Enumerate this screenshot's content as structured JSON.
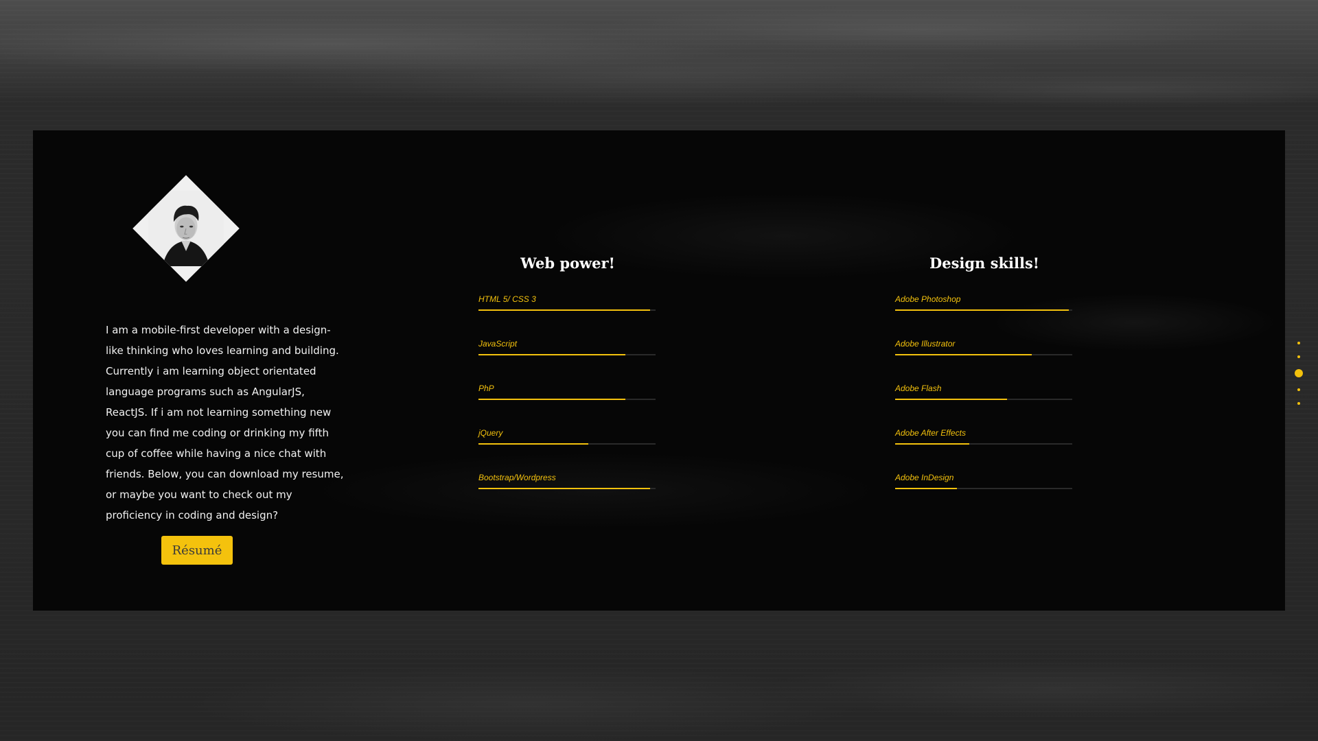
{
  "about": {
    "bio": "I am a mobile-first developer with a design-like thinking who loves learning and building. Currently i am learning object orientated language programs such as AngularJS, ReactJS. If i am not learning something new you can find me coding or drinking my fifth cup of coffee while having a nice chat with friends. Below, you can download my resume, or maybe you want to check out my proficiency in coding and design?",
    "resume_label": "Résumé"
  },
  "web": {
    "title": "Web power!",
    "skills": [
      {
        "label": "HTML 5/ CSS 3",
        "level": 0.97
      },
      {
        "label": "JavaScript",
        "level": 0.83
      },
      {
        "label": "PhP",
        "level": 0.83
      },
      {
        "label": "jQuery",
        "level": 0.62
      },
      {
        "label": "Bootstrap/Wordpress",
        "level": 0.97
      }
    ]
  },
  "design": {
    "title": "Design skills!",
    "skills": [
      {
        "label": "Adobe Photoshop",
        "level": 0.98
      },
      {
        "label": "Adobe Illustrator",
        "level": 0.77
      },
      {
        "label": "Adobe Flash",
        "level": 0.63
      },
      {
        "label": "Adobe After Effects",
        "level": 0.42
      },
      {
        "label": "Adobe InDesign",
        "level": 0.35
      }
    ]
  },
  "nav": {
    "dots": 5,
    "active_index": 2
  },
  "colors": {
    "accent": "#f4c20d",
    "panel": "#060606",
    "text": "#f2f2f2"
  }
}
